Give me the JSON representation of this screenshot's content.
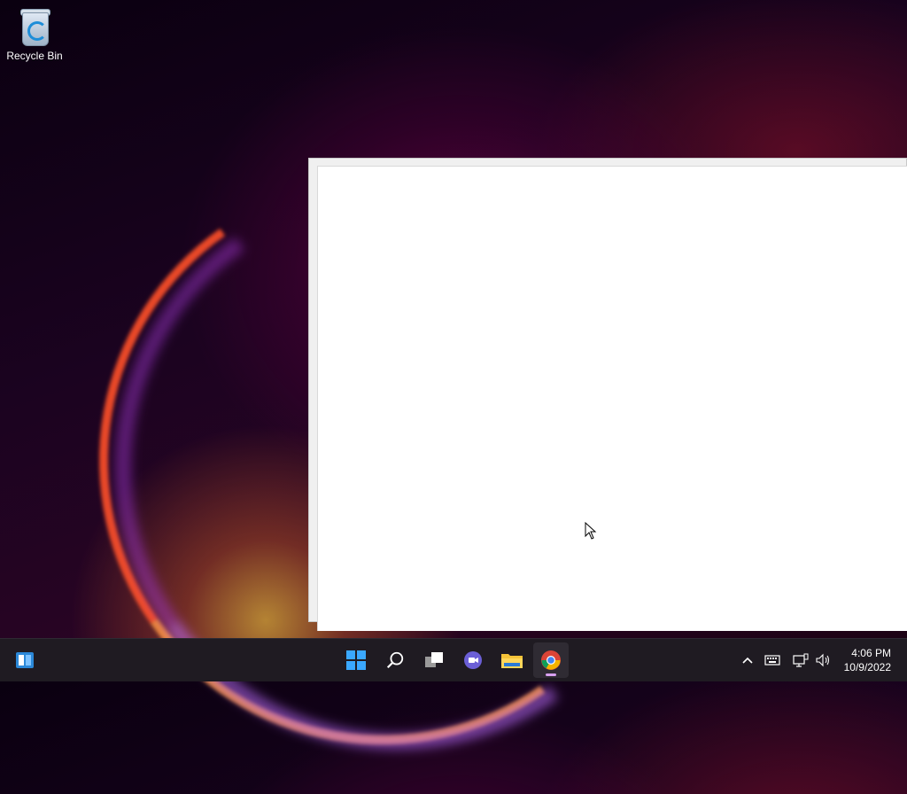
{
  "desktop": {
    "icons": [
      {
        "label": "Recycle Bin",
        "icon": "recycle-bin-icon"
      }
    ]
  },
  "window": {
    "state": "blank"
  },
  "taskbar": {
    "left": [
      {
        "icon": "widgets-icon"
      }
    ],
    "center": [
      {
        "icon": "windows-start-icon"
      },
      {
        "icon": "search-icon"
      },
      {
        "icon": "task-view-icon"
      },
      {
        "icon": "chat-icon"
      },
      {
        "icon": "file-explorer-icon"
      },
      {
        "icon": "chrome-icon",
        "active": true
      }
    ],
    "tray": [
      {
        "icon": "chevron-up-icon"
      },
      {
        "icon": "keyboard-icon"
      },
      {
        "icon": "network-icon"
      },
      {
        "icon": "volume-icon"
      }
    ],
    "clock": {
      "time": "4:06 PM",
      "date": "10/9/2022"
    }
  },
  "colors": {
    "taskbar": "#1f1b22",
    "accent": "#1e8ed8",
    "active_indicator": "#d8a0f0"
  }
}
